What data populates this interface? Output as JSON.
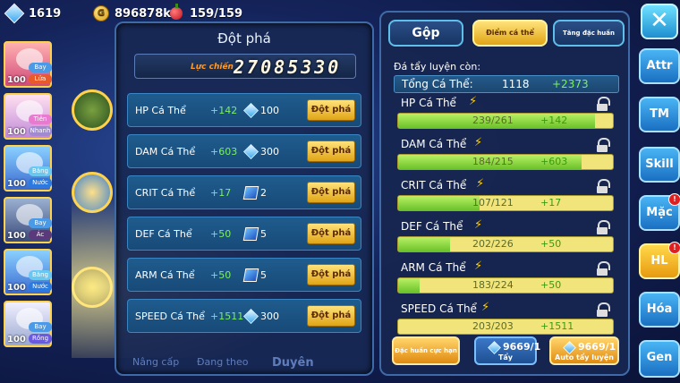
{
  "topbar": {
    "gems": "1619",
    "gold": "896878k",
    "stamina": "159/159"
  },
  "roster": [
    {
      "level": "100",
      "tags": [
        "Bay",
        "Lửa"
      ]
    },
    {
      "level": "100",
      "tags": [
        "Tiên",
        "Nhanh"
      ]
    },
    {
      "level": "100",
      "tags": [
        "Băng",
        "Nước"
      ]
    },
    {
      "level": "100",
      "tags": [
        "Bay",
        "Ác"
      ]
    },
    {
      "level": "100",
      "tags": [
        "Băng",
        "Nước"
      ]
    },
    {
      "level": "100",
      "tags": [
        "Bay",
        "Rồng"
      ]
    }
  ],
  "breakthrough": {
    "title": "Đột phá",
    "power_label": "Lực chiến",
    "power_value": "27085330",
    "rows": [
      {
        "name": "HP Cá Thể",
        "bonus": "+142",
        "cost_icon": "diamond-icon",
        "cost": "100",
        "button": "Đột phá"
      },
      {
        "name": "DAM Cá Thể",
        "bonus": "+603",
        "cost_icon": "diamond-icon",
        "cost": "300",
        "button": "Đột phá"
      },
      {
        "name": "CRIT Cá Thể",
        "bonus": "+17",
        "cost_icon": "ticket-icon",
        "cost": "2",
        "button": "Đột phá"
      },
      {
        "name": "DEF Cá Thể",
        "bonus": "+50",
        "cost_icon": "ticket-icon",
        "cost": "5",
        "button": "Đột phá"
      },
      {
        "name": "ARM Cá Thể",
        "bonus": "+50",
        "cost_icon": "ticket-icon",
        "cost": "5",
        "button": "Đột phá"
      },
      {
        "name": "SPEED Cá Thể",
        "bonus": "+1511",
        "cost_icon": "diamond-icon",
        "cost": "300",
        "button": "Đột phá"
      }
    ]
  },
  "background_tabs": [
    "Nâng cấp",
    "Đang theo",
    "Duyên"
  ],
  "training": {
    "tabs": [
      "Gộp",
      "Điểm cá thể",
      "Tăng đặc huấn"
    ],
    "active_tab": 1,
    "remaining_label": "Đá tẩy luyện còn:",
    "total_label": "Tổng Cá Thể:",
    "total_value": "1118",
    "total_bonus": "+2373",
    "stats": [
      {
        "name": "HP Cá Thể",
        "value": "239/261",
        "bonus": "+142",
        "fill": 0.916
      },
      {
        "name": "DAM Cá Thể",
        "value": "184/215",
        "bonus": "+603",
        "fill": 0.856
      },
      {
        "name": "CRIT Cá Thể",
        "value": "107/121",
        "bonus": "+17",
        "fill": 0.38
      },
      {
        "name": "DEF Cá Thể",
        "value": "202/226",
        "bonus": "+50",
        "fill": 0.24
      },
      {
        "name": "ARM Cá Thể",
        "value": "183/224",
        "bonus": "+50",
        "fill": 0.1
      },
      {
        "name": "SPEED Cá Thể",
        "value": "203/203",
        "bonus": "+1511",
        "fill": 0.0
      }
    ],
    "footer": {
      "special_button": "Đặc huấn cực hạn",
      "wash_count": "9669/1",
      "wash_label": "Tẩy",
      "auto_count": "9669/1",
      "auto_label": "Auto tẩy luyện"
    }
  },
  "side_menu": {
    "close": "✕",
    "items": [
      {
        "label": "Attr",
        "active": false,
        "badge": false
      },
      {
        "label": "TM",
        "active": false,
        "badge": false
      },
      {
        "label": "Skill",
        "active": false,
        "badge": false
      },
      {
        "label": "Mặc",
        "active": false,
        "badge": true
      },
      {
        "label": "HL",
        "active": true,
        "badge": true
      },
      {
        "label": "Hóa",
        "active": false,
        "badge": false
      },
      {
        "label": "Gen",
        "active": false,
        "badge": false
      }
    ],
    "badge_text": "!"
  },
  "colors": {
    "accent": "#ffd24a",
    "bonus_green": "#7cf060",
    "panel": "#182854"
  }
}
